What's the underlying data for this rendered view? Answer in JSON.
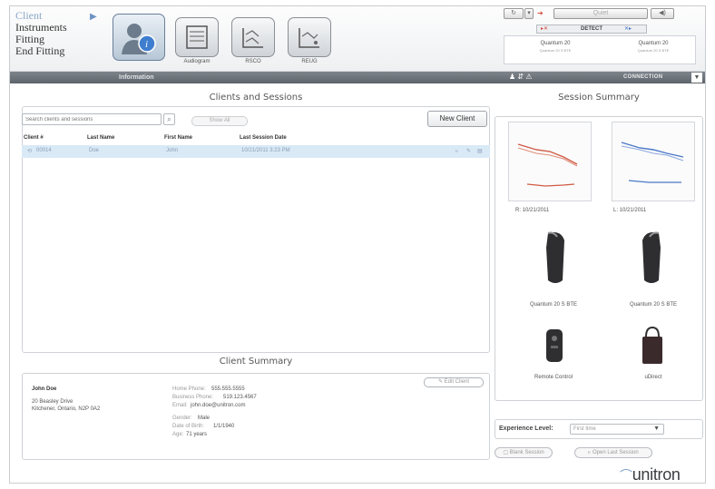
{
  "nav": {
    "client": "Client",
    "instruments": "Instruments",
    "fitting": "Fitting",
    "end_fitting": "End Fitting"
  },
  "toolbar": {
    "audiogram": "Audiogram",
    "rsco": "RSCO",
    "reug": "REUG"
  },
  "infobar": {
    "tab": "Information",
    "connection": "CONNECTION"
  },
  "device_panel": {
    "quiet": "Quiet",
    "detect": "DETECT",
    "left": {
      "name": "Quantum 20",
      "model": "Quantum 20 S BTE"
    },
    "right": {
      "name": "Quantum 20",
      "model": "Quantum 20 S BTE"
    }
  },
  "clients": {
    "title": "Clients and Sessions",
    "search_placeholder": "Search clients and sessions",
    "show_all": "Show All",
    "new_client": "New Client",
    "columns": [
      "Client #",
      "Last Name",
      "First Name",
      "Last Session Date"
    ],
    "rows": [
      {
        "client_no": "00014",
        "last_name": "Doe",
        "first_name": "John",
        "date": "10/21/2011 3:23 PM"
      }
    ]
  },
  "client_summary": {
    "title": "Client Summary",
    "name": "John Doe",
    "address1": "20 Beasley Drive",
    "address2": "Kitchener, Ontario, N2P 0A2",
    "home_phone_label": "Home Phone:",
    "home_phone": "555.555.5555",
    "business_phone_label": "Business Phone:",
    "business_phone": "519.123.4567",
    "email_label": "Email:",
    "email": "john.doe@unitron.com",
    "gender_label": "Gender:",
    "gender": "Male",
    "dob_label": "Date of Birth:",
    "dob": "1/1/1940",
    "age_label": "Age:",
    "age": "71 years",
    "edit": "Edit Client"
  },
  "session_summary": {
    "title": "Session Summary",
    "right_date": "R: 10/21/2011",
    "left_date": "L: 10/21/2011",
    "device_right": "Quantum 20 S BTE",
    "device_left": "Quantum 20 S BTE",
    "remote": "Remote Control",
    "udirect": "uDirect"
  },
  "experience": {
    "label": "Experience Level:",
    "value": "First time"
  },
  "buttons": {
    "blank_session": "Blank Session",
    "open_last": "Open Last Session"
  },
  "logo": "unitron",
  "colors": {
    "accent": "#8aa7c8",
    "right_ear": "#d05a44",
    "left_ear": "#4a78c8",
    "selection": "#d9e9f6"
  }
}
